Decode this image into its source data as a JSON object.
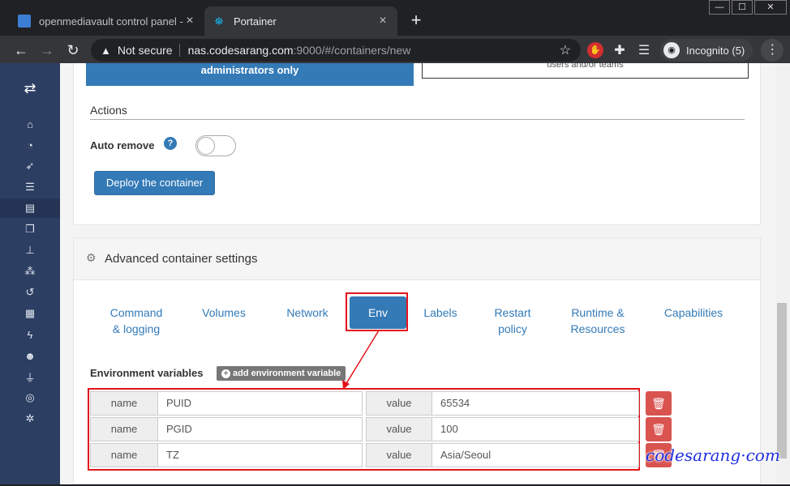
{
  "browser": {
    "tabs": [
      {
        "title": "openmediavault control panel - n",
        "active": false
      },
      {
        "title": "Portainer",
        "active": true
      }
    ],
    "new_tab": "+",
    "window_controls": [
      "—",
      "☐",
      "✕"
    ],
    "security_label": "Not secure",
    "url_host": "nas.codesarang.com",
    "url_path": ":9000/#/containers/new",
    "incognito_label": "Incognito (5)"
  },
  "icons": {
    "sidebar": [
      "home-icon",
      "dashboard-icon",
      "rocket-icon",
      "list-icon",
      "server-icon",
      "copy-icon",
      "sitemap-icon",
      "cubes-icon",
      "history-icon",
      "th-icon",
      "bolt-icon",
      "users-icon",
      "plug-icon",
      "database-icon",
      "cogs-icon"
    ]
  },
  "top_section": {
    "admin_button_label": "administrators only",
    "right_box_text": "users and/or teams",
    "actions_label": "Actions",
    "auto_remove_label": "Auto remove",
    "auto_remove_enabled": false,
    "deploy_button_label": "Deploy the container"
  },
  "advanced": {
    "title": "Advanced container settings",
    "tabs": [
      {
        "label": "Command\n& logging"
      },
      {
        "label": "Volumes"
      },
      {
        "label": "Network"
      },
      {
        "label": "Env",
        "active": true
      },
      {
        "label": "Labels"
      },
      {
        "label": "Restart\npolicy"
      },
      {
        "label": "Runtime &\nResources"
      },
      {
        "label": "Capabilities"
      }
    ],
    "env_label": "Environment variables",
    "add_env_button_label": "add environment variable",
    "env_vars": [
      {
        "name_addon": "name",
        "name": "PUID",
        "value_addon": "value",
        "value": "65534"
      },
      {
        "name_addon": "name",
        "name": "PGID",
        "value_addon": "value",
        "value": "100"
      },
      {
        "name_addon": "name",
        "name": "TZ",
        "value_addon": "value",
        "value": "Asia/Seoul"
      }
    ]
  },
  "watermark": "codesarang·com",
  "colors": {
    "primary": "#337ab7",
    "sidebar": "#2d3e63",
    "danger": "#d9534f",
    "annotation": "#e3131b"
  }
}
